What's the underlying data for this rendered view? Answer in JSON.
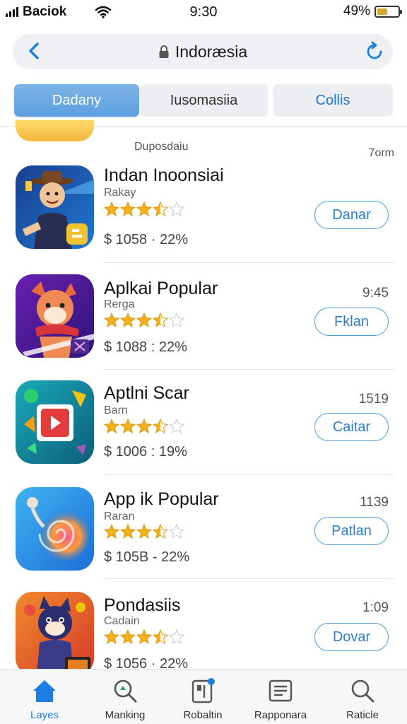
{
  "status": {
    "carrier": "Baciok",
    "time": "9:30",
    "battery": "49%",
    "battery_level": 0.49
  },
  "urlbar": {
    "title": "Indoræsia"
  },
  "tabs": [
    {
      "label": "Dadany",
      "active": true
    },
    {
      "label": "Iusomasiia",
      "active": false
    },
    {
      "label": "Collis",
      "active": false
    }
  ],
  "section": {
    "heading": "Duposdaiu",
    "count": "7orm"
  },
  "items": [
    {
      "title": "Indan Inoonsiai",
      "subtitle": "Rakay",
      "rating": 3.5,
      "price": "$ 1058 · 22%",
      "meta": "",
      "action": "Danar"
    },
    {
      "title": "Aplkai Popular",
      "subtitle": "Rerga",
      "rating": 3.5,
      "price": "$ 1088 : 22%",
      "meta": "9:45",
      "action": "Fklan"
    },
    {
      "title": "Aptlni Scar",
      "subtitle": "Barn",
      "rating": 3.5,
      "price": "$ 1006 : 19%",
      "meta": "1519",
      "action": "Caitar"
    },
    {
      "title": "App ik Popular",
      "subtitle": "Raran",
      "rating": 3.5,
      "price": "$ 105B - 22%",
      "meta": "1139",
      "action": "Patlan"
    },
    {
      "title": "Pondasiis",
      "subtitle": "Cadain",
      "rating": 3.5,
      "price": "$ 1056 · 22%",
      "meta": "1:09",
      "action": "Dovar"
    }
  ],
  "nav": [
    {
      "label": "Layes",
      "icon": "home-icon",
      "active": true
    },
    {
      "label": "Manking",
      "icon": "search-icon",
      "active": false
    },
    {
      "label": "Robaltin",
      "icon": "updates-icon",
      "active": false
    },
    {
      "label": "Rapponara",
      "icon": "list-icon",
      "active": false
    },
    {
      "label": "Raticle",
      "icon": "search-icon",
      "active": false
    }
  ],
  "colors": {
    "accent": "#1b7ee0",
    "tab_active": "#6aa8e3",
    "star": "#f2b01e"
  }
}
